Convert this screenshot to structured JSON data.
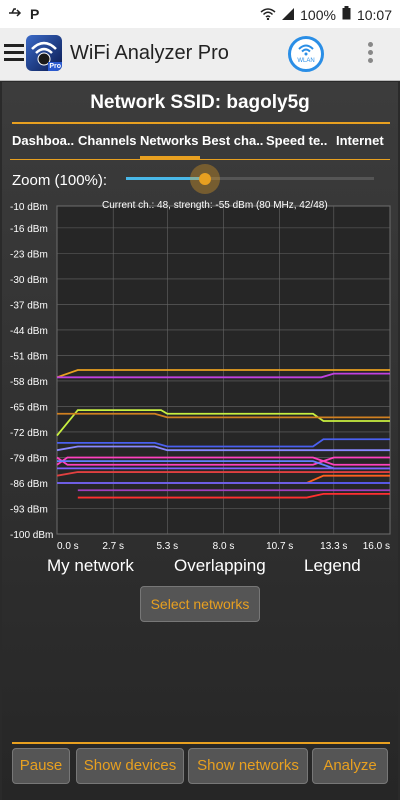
{
  "status_bar": {
    "time": "10:07",
    "battery": "100%"
  },
  "app": {
    "title": "WiFi Analyzer Pro",
    "wlan_label": "WLAN",
    "logo_badge": "Pro"
  },
  "network": {
    "ssid_label": "Network SSID: bagoly5g"
  },
  "tabs": [
    {
      "label": "Dashboa.."
    },
    {
      "label": "Channels"
    },
    {
      "label": "Networks"
    },
    {
      "label": "Best cha.."
    },
    {
      "label": "Speed te.."
    },
    {
      "label": "Internet"
    }
  ],
  "active_tab": "Networks",
  "zoom": {
    "label": "Zoom (100%):",
    "value_percent": 32
  },
  "current_channel": "Current ch.: 48, strength: -55 dBm (80 MHz, 42/48)",
  "chart_data": {
    "type": "line",
    "y_ticks": [
      "-10 dBm",
      "-16 dBm",
      "-23 dBm",
      "-30 dBm",
      "-37 dBm",
      "-44 dBm",
      "-51 dBm",
      "-58 dBm",
      "-65 dBm",
      "-72 dBm",
      "-79 dBm",
      "-86 dBm",
      "-93 dBm",
      "-100 dBm"
    ],
    "y_values": [
      -10,
      -16,
      -23,
      -30,
      -37,
      -44,
      -51,
      -58,
      -65,
      -72,
      -79,
      -86,
      -93,
      -100
    ],
    "x_ticks": [
      "0.0 s",
      "2.7 s",
      "5.3 s",
      "8.0 s",
      "10.7 s",
      "13.3 s",
      "16.0 s"
    ],
    "x_values": [
      0,
      2.7,
      5.3,
      8.0,
      10.7,
      13.3,
      16.0
    ],
    "xlim": [
      0,
      16
    ],
    "ylim": [
      -100,
      -10
    ],
    "grid": true,
    "series": [
      {
        "color": "#e8a020",
        "x": [
          0,
          1,
          16
        ],
        "y": [
          -57,
          -55,
          -55
        ]
      },
      {
        "color": "#c040e0",
        "x": [
          0,
          12.7,
          13.3,
          16
        ],
        "y": [
          -57,
          -57,
          -56,
          -56
        ]
      },
      {
        "color": "#c8f040",
        "x": [
          0,
          1,
          5,
          5.3,
          12.3,
          12.8,
          16
        ],
        "y": [
          -73,
          -66,
          -66,
          -67,
          -67,
          -69,
          -69
        ]
      },
      {
        "color": "#d08020",
        "x": [
          0,
          4.7,
          5.3,
          12.3,
          16
        ],
        "y": [
          -67,
          -67,
          -68,
          -68,
          -68
        ]
      },
      {
        "color": "#4a60f0",
        "x": [
          0,
          4.7,
          5.3,
          12.3,
          12.8,
          16
        ],
        "y": [
          -75,
          -75,
          -76,
          -76,
          -74,
          -74
        ]
      },
      {
        "color": "#8888ff",
        "x": [
          0,
          1,
          4.7,
          5.3,
          12.3,
          16
        ],
        "y": [
          -77,
          -76,
          -76,
          -77,
          -77,
          -77
        ]
      },
      {
        "color": "#ff40c0",
        "x": [
          0,
          0.5,
          1,
          12.3,
          13.3,
          16
        ],
        "y": [
          -81,
          -79,
          -79,
          -79,
          -81,
          -81
        ]
      },
      {
        "color": "#ff40c0",
        "x": [
          0,
          0.5,
          1,
          12.3,
          13.3,
          16
        ],
        "y": [
          -79,
          -81,
          -81,
          -81,
          -79,
          -79
        ]
      },
      {
        "color": "#6080ff",
        "x": [
          0,
          1,
          12.3,
          13.3,
          16
        ],
        "y": [
          -80,
          -80,
          -80,
          -82,
          -82
        ]
      },
      {
        "color": "#8060ff",
        "x": [
          0,
          1,
          16
        ],
        "y": [
          -82,
          -82,
          -82
        ]
      },
      {
        "color": "#e04040",
        "x": [
          0,
          1,
          12.3,
          12.8,
          16
        ],
        "y": [
          -84,
          -83,
          -83,
          -83,
          -83
        ]
      },
      {
        "color": "#ff6020",
        "x": [
          0,
          1,
          12,
          12.8,
          16
        ],
        "y": [
          -86,
          -86,
          -86,
          -84,
          -84
        ]
      },
      {
        "color": "#6060ff",
        "x": [
          0,
          1,
          12.3,
          16
        ],
        "y": [
          -86,
          -86,
          -86,
          -86
        ]
      },
      {
        "color": "#ff3030",
        "x": [
          1,
          12,
          12.8,
          16
        ],
        "y": [
          -90,
          -90,
          -89,
          -89
        ]
      },
      {
        "color": "#a040c0",
        "x": [
          1,
          16
        ],
        "y": [
          -88,
          -88
        ]
      }
    ]
  },
  "legend_row": {
    "my_network": "My network",
    "overlapping": "Overlapping",
    "legend": "Legend"
  },
  "select_networks": "Select networks",
  "bottom_buttons": {
    "pause": "Pause",
    "show_devices": "Show devices",
    "show_networks": "Show networks",
    "analyze": "Analyze"
  }
}
